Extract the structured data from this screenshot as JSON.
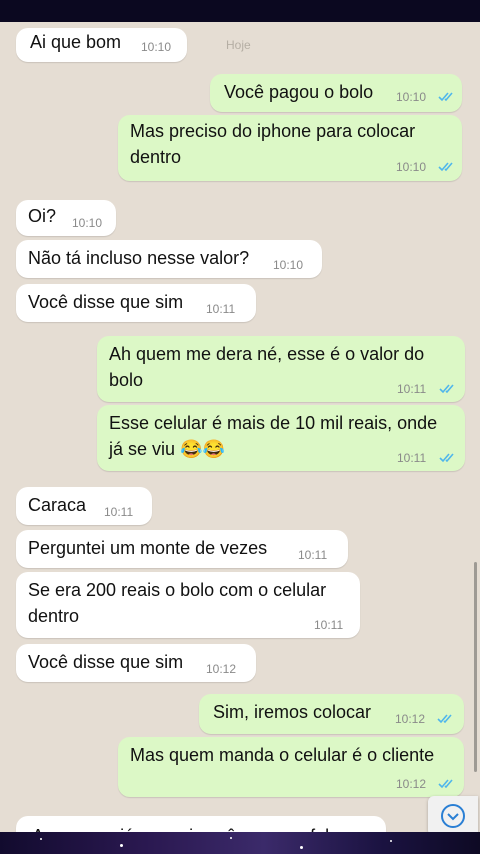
{
  "date_chip": "Hoje",
  "messages": [
    {
      "text": "Ai que bom",
      "time": "10:10"
    },
    {
      "text": "Você pagou o bolo",
      "time": "10:10"
    },
    {
      "text": [
        "Mas preciso do iphone para colocar",
        "dentro"
      ],
      "time": "10:10"
    },
    {
      "text": "Oi?",
      "time": "10:10"
    },
    {
      "text": "Não tá incluso nesse valor?",
      "time": "10:10"
    },
    {
      "text": "Você disse que sim",
      "time": "10:11"
    },
    {
      "text": [
        "Ah quem me dera né, esse é o valor do",
        "bolo"
      ],
      "time": "10:11"
    },
    {
      "text": [
        "Esse celular é mais de 10 mil reais, onde",
        "já se viu 😂😂"
      ],
      "time": "10:11"
    },
    {
      "text": "Caraca",
      "time": "10:11"
    },
    {
      "text": "Perguntei um monte de vezes",
      "time": "10:11"
    },
    {
      "text": [
        "Se era 200 reais o bolo com o celular",
        "dentro"
      ],
      "time": "10:11"
    },
    {
      "text": "Você disse que sim",
      "time": "10:12"
    },
    {
      "text": "Sim, iremos colocar",
      "time": "10:12"
    },
    {
      "text": "Mas quem manda o celular é o cliente",
      "time": "10:12"
    },
    {
      "text": "Agora que já peguei você vem me falar",
      "time": ""
    }
  ],
  "colors": {
    "incoming": "#ffffff",
    "outgoing": "#dcf8c6",
    "read_ticks": "#4fb6ec",
    "background": "#e5ddd3"
  },
  "icons": {
    "read_receipt": "double-check-icon",
    "scroll_down": "chevron-down-icon"
  }
}
